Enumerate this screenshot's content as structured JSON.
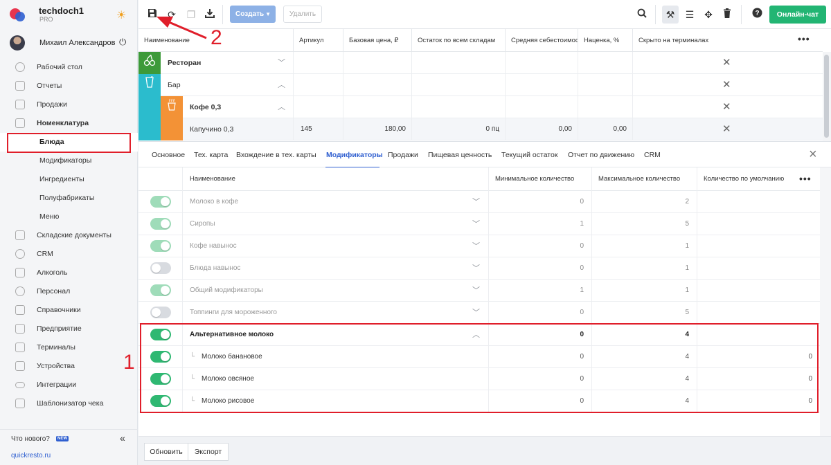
{
  "brand": {
    "name": "techdoch1",
    "plan": "PRO"
  },
  "user": {
    "name": "Михаил Александров"
  },
  "nav": {
    "items": [
      {
        "label": "Рабочий стол"
      },
      {
        "label": "Отчеты"
      },
      {
        "label": "Продажи"
      },
      {
        "label": "Номенклатура"
      },
      {
        "label": "Блюда"
      },
      {
        "label": "Модификаторы"
      },
      {
        "label": "Ингредиенты"
      },
      {
        "label": "Полуфабрикаты"
      },
      {
        "label": "Меню"
      },
      {
        "label": "Складские документы"
      },
      {
        "label": "CRM"
      },
      {
        "label": "Алкоголь"
      },
      {
        "label": "Персонал"
      },
      {
        "label": "Справочники"
      },
      {
        "label": "Предприятие"
      },
      {
        "label": "Терминалы"
      },
      {
        "label": "Устройства"
      },
      {
        "label": "Интеграции"
      },
      {
        "label": "Шаблонизатор чека"
      }
    ],
    "active": "Блюда"
  },
  "footer": {
    "whats_new": "Что нового?",
    "new_badge": "NEW",
    "site": "quickresto.ru"
  },
  "toolbar": {
    "create_label": "Создать",
    "delete_label": "Удалить",
    "chat_label": "Онлайн-чат",
    "icons": [
      "save-icon",
      "refresh-icon",
      "copy-icon",
      "download-icon",
      "search-icon",
      "tools-icon",
      "list-icon",
      "move-icon",
      "trash-icon",
      "help-icon"
    ]
  },
  "top_table": {
    "headers": [
      "Наименование",
      "Артикул",
      "Базовая цена, ₽",
      "Остаток по всем складам",
      "Средняя себестоимость",
      "Наценка, %",
      "Скрыто на терминалах"
    ],
    "rows": [
      {
        "name": "Ресторан",
        "category_color": "#3d9a3a",
        "icon": "cherries-icon",
        "expanded": false
      },
      {
        "name": "Бар",
        "category_color": "#2bbccd",
        "icon": "cocktail-icon",
        "expanded": true
      },
      {
        "name": "Кофе 0,3",
        "category_color": "#f39236",
        "icon": "coffee-cup-icon",
        "expanded": true
      },
      {
        "name": "Капучино 0,3",
        "article": "145",
        "price": "180,00",
        "stock": "0 пц",
        "avg_cost": "0,00",
        "markup": "0,00"
      }
    ]
  },
  "tabs": {
    "items": [
      "Основное",
      "Тех. карта",
      "Вхождение в тех. карты",
      "Модификаторы",
      "Продажи",
      "Пищевая ценность",
      "Текущий остаток",
      "Отчет по движению",
      "CRM"
    ],
    "active": "Модификаторы"
  },
  "modifiers": {
    "headers": {
      "name": "Наименование",
      "min": "Минимальное количество",
      "max": "Максимальное количество",
      "default": "Количество по умолчанию"
    },
    "rows": [
      {
        "name": "Молоко в кофе",
        "enabled": true,
        "dimmed": true,
        "min": "0",
        "max": "2",
        "default": ""
      },
      {
        "name": "Сиропы",
        "enabled": true,
        "dimmed": true,
        "min": "1",
        "max": "5",
        "default": ""
      },
      {
        "name": "Кофе навынос",
        "enabled": true,
        "dimmed": true,
        "min": "0",
        "max": "1",
        "default": ""
      },
      {
        "name": "Блюда навынос",
        "enabled": false,
        "dimmed": true,
        "min": "0",
        "max": "1",
        "default": ""
      },
      {
        "name": "Общий модификаторы",
        "enabled": true,
        "dimmed": true,
        "min": "1",
        "max": "1",
        "default": ""
      },
      {
        "name": "Топпинги для мороженного",
        "enabled": false,
        "dimmed": true,
        "min": "0",
        "max": "5",
        "default": ""
      },
      {
        "name": "Альтернативное молоко",
        "enabled": true,
        "group": true,
        "expanded": true,
        "min": "0",
        "max": "4",
        "default": ""
      },
      {
        "name": "Молоко банановое",
        "enabled": true,
        "child": true,
        "min": "0",
        "max": "4",
        "default": "0"
      },
      {
        "name": "Молоко овсяное",
        "enabled": true,
        "child": true,
        "min": "0",
        "max": "4",
        "default": "0"
      },
      {
        "name": "Молоко рисовое",
        "enabled": true,
        "child": true,
        "min": "0",
        "max": "4",
        "default": "0"
      }
    ]
  },
  "bottom": {
    "refresh_label": "Обновить",
    "export_label": "Экспорт"
  },
  "annotations": {
    "label_1": "1",
    "label_2": "2",
    "color": "#e01e2a"
  }
}
